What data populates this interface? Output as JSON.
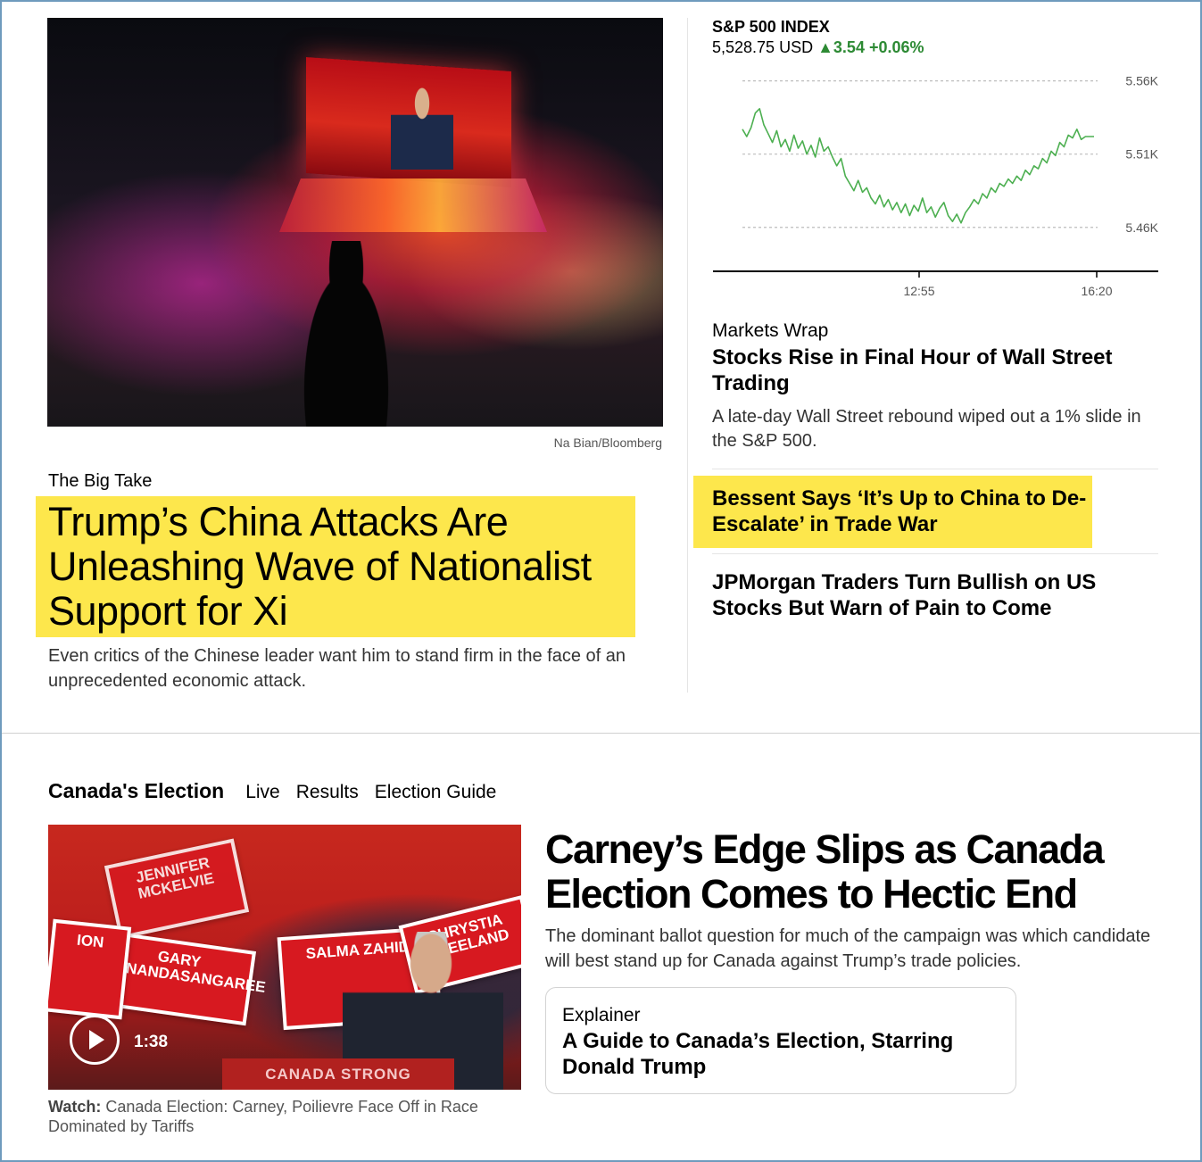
{
  "hero": {
    "image_alt": "Night street scene with large video screen",
    "credit": "Na Bian/Bloomberg",
    "kicker": "The Big Take",
    "title": "Trump’s China Attacks Are Unleashing Wave of Nationalist Support for Xi",
    "summary": "Even critics of the Chinese leader want him to stand firm in the face of an unprecedented economic attack.",
    "highlight_color": "#fde74c"
  },
  "market": {
    "name": "S&P 500 INDEX",
    "price": "5,528.75 USD",
    "change_arrow": "▲",
    "change_value": "3.54",
    "change_pct": "+0.06%",
    "up_color": "#2d8a34",
    "chart_data": {
      "type": "line",
      "title": "",
      "y_ticks": [
        "5.56K",
        "5.51K",
        "5.46K"
      ],
      "y_tick_values": [
        5560,
        5510,
        5460
      ],
      "x_ticks": [
        "12:55",
        "16:20"
      ],
      "ylim": [
        5430,
        5575
      ],
      "series": [
        {
          "values": [
            5527,
            5522,
            5528,
            5538,
            5541,
            5530,
            5524,
            5518,
            5526,
            5515,
            5520,
            5512,
            5523,
            5514,
            5519,
            5510,
            5516,
            5508,
            5521,
            5512,
            5515,
            5508,
            5502,
            5507,
            5495,
            5490,
            5485,
            5492,
            5484,
            5487,
            5480,
            5476,
            5482,
            5474,
            5479,
            5472,
            5477,
            5470,
            5476,
            5468,
            5475,
            5471,
            5480,
            5470,
            5474,
            5467,
            5473,
            5477,
            5468,
            5464,
            5469,
            5463,
            5470,
            5474,
            5479,
            5476,
            5483,
            5480,
            5487,
            5484,
            5490,
            5488,
            5493,
            5490,
            5495,
            5492,
            5499,
            5496,
            5502,
            5500,
            5507,
            5504,
            5512,
            5509,
            5518,
            5515,
            5523,
            5521,
            5527,
            5520,
            5522,
            5522,
            5522
          ],
          "color": "#4caf50"
        }
      ]
    }
  },
  "markets_wrap": {
    "kicker": "Markets Wrap",
    "title": "Stocks Rise in Final Hour of Wall Street Trading",
    "summary": "A late-day Wall Street rebound wiped out a 1% slide in the S&P 500."
  },
  "stories": {
    "bessent": "Bessent Says ‘It’s Up to China to De-Escalate’ in Trade War",
    "jpmorgan": "JPMorgan Traders Turn Bullish on US Stocks But Warn of Pain to Come"
  },
  "canada": {
    "section_title": "Canada's Election",
    "tabs": [
      "Live",
      "Results",
      "Election Guide"
    ],
    "video": {
      "duration": "1:38",
      "sign_texts": [
        "JENNIFER MCKELVIE",
        "GARY ANANDASANGAREE",
        "SALMA ZAHID",
        "CHRYSTIA FREELAND",
        "ION"
      ],
      "banner": "CANADA STRONG"
    },
    "watch_label": "Watch:",
    "watch_text": "Canada Election: Carney, Poilievre Face Off in Race Dominated by Tariffs",
    "title": "Carney’s Edge Slips as Canada Election Comes to Hectic End",
    "summary": "The dominant ballot question for much of the campaign was which candidate will best stand up for Canada against Trump’s trade policies.",
    "explainer_kicker": "Explainer",
    "explainer_title": "A Guide to Canada’s Election, Starring Donald Trump"
  }
}
